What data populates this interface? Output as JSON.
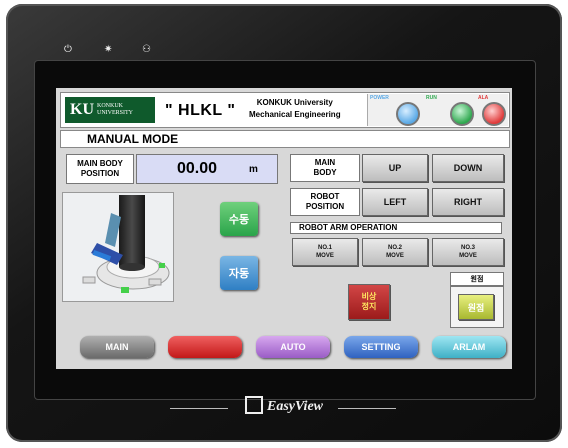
{
  "device": {
    "brand": "EasyView"
  },
  "header": {
    "logo_main": "KU",
    "logo_sub_1": "KONKUK",
    "logo_sub_2": "UNIVERSITY",
    "title": "\" HLKL \"",
    "subtitle_1": "KONKUK University",
    "subtitle_2": "Mechanical Engineering",
    "lamps": [
      {
        "label": "POWER",
        "color": "#5aa9e6"
      },
      {
        "label": "RUN",
        "color": "#2fa84f"
      },
      {
        "label": "ALA",
        "color": "#e03a3a"
      }
    ]
  },
  "mode": {
    "title": "MANUAL MODE"
  },
  "position": {
    "label_1": "MAIN BODY",
    "label_2": "POSITION",
    "value": "00.00",
    "unit": "m"
  },
  "main_body": {
    "label_1": "MAIN",
    "label_2": "BODY",
    "up": "UP",
    "down": "DOWN"
  },
  "robot_position": {
    "label_1": "ROBOT",
    "label_2": "POSITION",
    "left": "LEFT",
    "right": "RIGHT"
  },
  "robot_arm": {
    "title": "ROBOT ARM OPERATION",
    "moves": [
      {
        "line1": "NO.1",
        "line2": "MOVE"
      },
      {
        "line1": "NO.2",
        "line2": "MOVE"
      },
      {
        "line1": "NO.3",
        "line2": "MOVE"
      }
    ]
  },
  "manual_btn": "수동",
  "auto_btn": "자동",
  "estop": {
    "line1": "비상",
    "line2": "정지"
  },
  "origin": {
    "label": "원점",
    "button": "원점"
  },
  "nav": [
    {
      "label": "MAIN",
      "color": "#8a8a8a"
    },
    {
      "label": "",
      "color": "#d22525"
    },
    {
      "label": "AUTO",
      "color": "#b27ad6"
    },
    {
      "label": "SETTING",
      "color": "#3f73d0"
    },
    {
      "label": "ARLAM",
      "color": "#5fc4d6"
    }
  ]
}
